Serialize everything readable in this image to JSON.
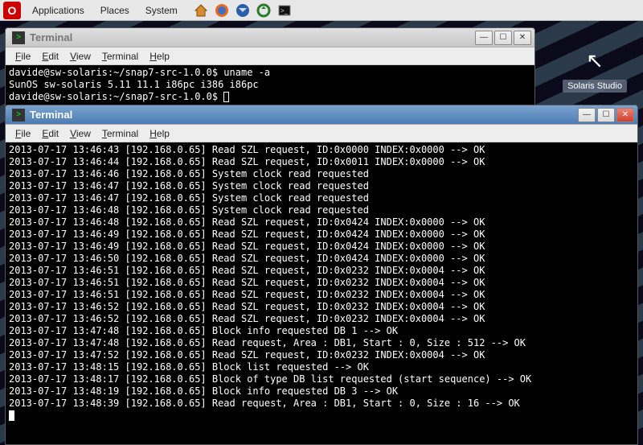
{
  "panel": {
    "menus": [
      "Applications",
      "Places",
      "System"
    ],
    "icons": [
      "home-icon",
      "firefox-icon",
      "thunderbird-icon",
      "update-icon",
      "terminal-icon"
    ]
  },
  "desktop": {
    "icon": {
      "label": "Solaris Studio",
      "glyph": "↖"
    }
  },
  "windows": {
    "back": {
      "title": "Terminal",
      "menus": [
        "File",
        "Edit",
        "View",
        "Terminal",
        "Help"
      ],
      "lines": [
        "davide@sw-solaris:~/snap7-src-1.0.0$ uname -a",
        "SunOS sw-solaris 5.11 11.1 i86pc i386 i86pc",
        "davide@sw-solaris:~/snap7-src-1.0.0$ "
      ]
    },
    "front": {
      "title": "Terminal",
      "menus": [
        "File",
        "Edit",
        "View",
        "Terminal",
        "Help"
      ],
      "lines": [
        "2013-07-17 13:46:43 [192.168.0.65] Read SZL request, ID:0x0000 INDEX:0x0000 --> OK",
        "2013-07-17 13:46:44 [192.168.0.65] Read SZL request, ID:0x0011 INDEX:0x0000 --> OK",
        "2013-07-17 13:46:46 [192.168.0.65] System clock read requested",
        "2013-07-17 13:46:47 [192.168.0.65] System clock read requested",
        "2013-07-17 13:46:47 [192.168.0.65] System clock read requested",
        "2013-07-17 13:46:48 [192.168.0.65] System clock read requested",
        "2013-07-17 13:46:48 [192.168.0.65] Read SZL request, ID:0x0424 INDEX:0x0000 --> OK",
        "2013-07-17 13:46:49 [192.168.0.65] Read SZL request, ID:0x0424 INDEX:0x0000 --> OK",
        "2013-07-17 13:46:49 [192.168.0.65] Read SZL request, ID:0x0424 INDEX:0x0000 --> OK",
        "2013-07-17 13:46:50 [192.168.0.65] Read SZL request, ID:0x0424 INDEX:0x0000 --> OK",
        "2013-07-17 13:46:51 [192.168.0.65] Read SZL request, ID:0x0232 INDEX:0x0004 --> OK",
        "2013-07-17 13:46:51 [192.168.0.65] Read SZL request, ID:0x0232 INDEX:0x0004 --> OK",
        "2013-07-17 13:46:51 [192.168.0.65] Read SZL request, ID:0x0232 INDEX:0x0004 --> OK",
        "2013-07-17 13:46:52 [192.168.0.65] Read SZL request, ID:0x0232 INDEX:0x0004 --> OK",
        "2013-07-17 13:46:52 [192.168.0.65] Read SZL request, ID:0x0232 INDEX:0x0004 --> OK",
        "2013-07-17 13:47:48 [192.168.0.65] Block info requested DB 1 --> OK",
        "2013-07-17 13:47:48 [192.168.0.65] Read request, Area : DB1, Start : 0, Size : 512 --> OK",
        "2013-07-17 13:47:52 [192.168.0.65] Read SZL request, ID:0x0232 INDEX:0x0004 --> OK",
        "2013-07-17 13:48:15 [192.168.0.65] Block list requested --> OK",
        "2013-07-17 13:48:17 [192.168.0.65] Block of type DB list requested (start sequence) --> OK",
        "2013-07-17 13:48:19 [192.168.0.65] Block info requested DB 3 --> OK",
        "2013-07-17 13:48:39 [192.168.0.65] Read request, Area : DB1, Start : 0, Size : 16 --> OK"
      ]
    }
  }
}
